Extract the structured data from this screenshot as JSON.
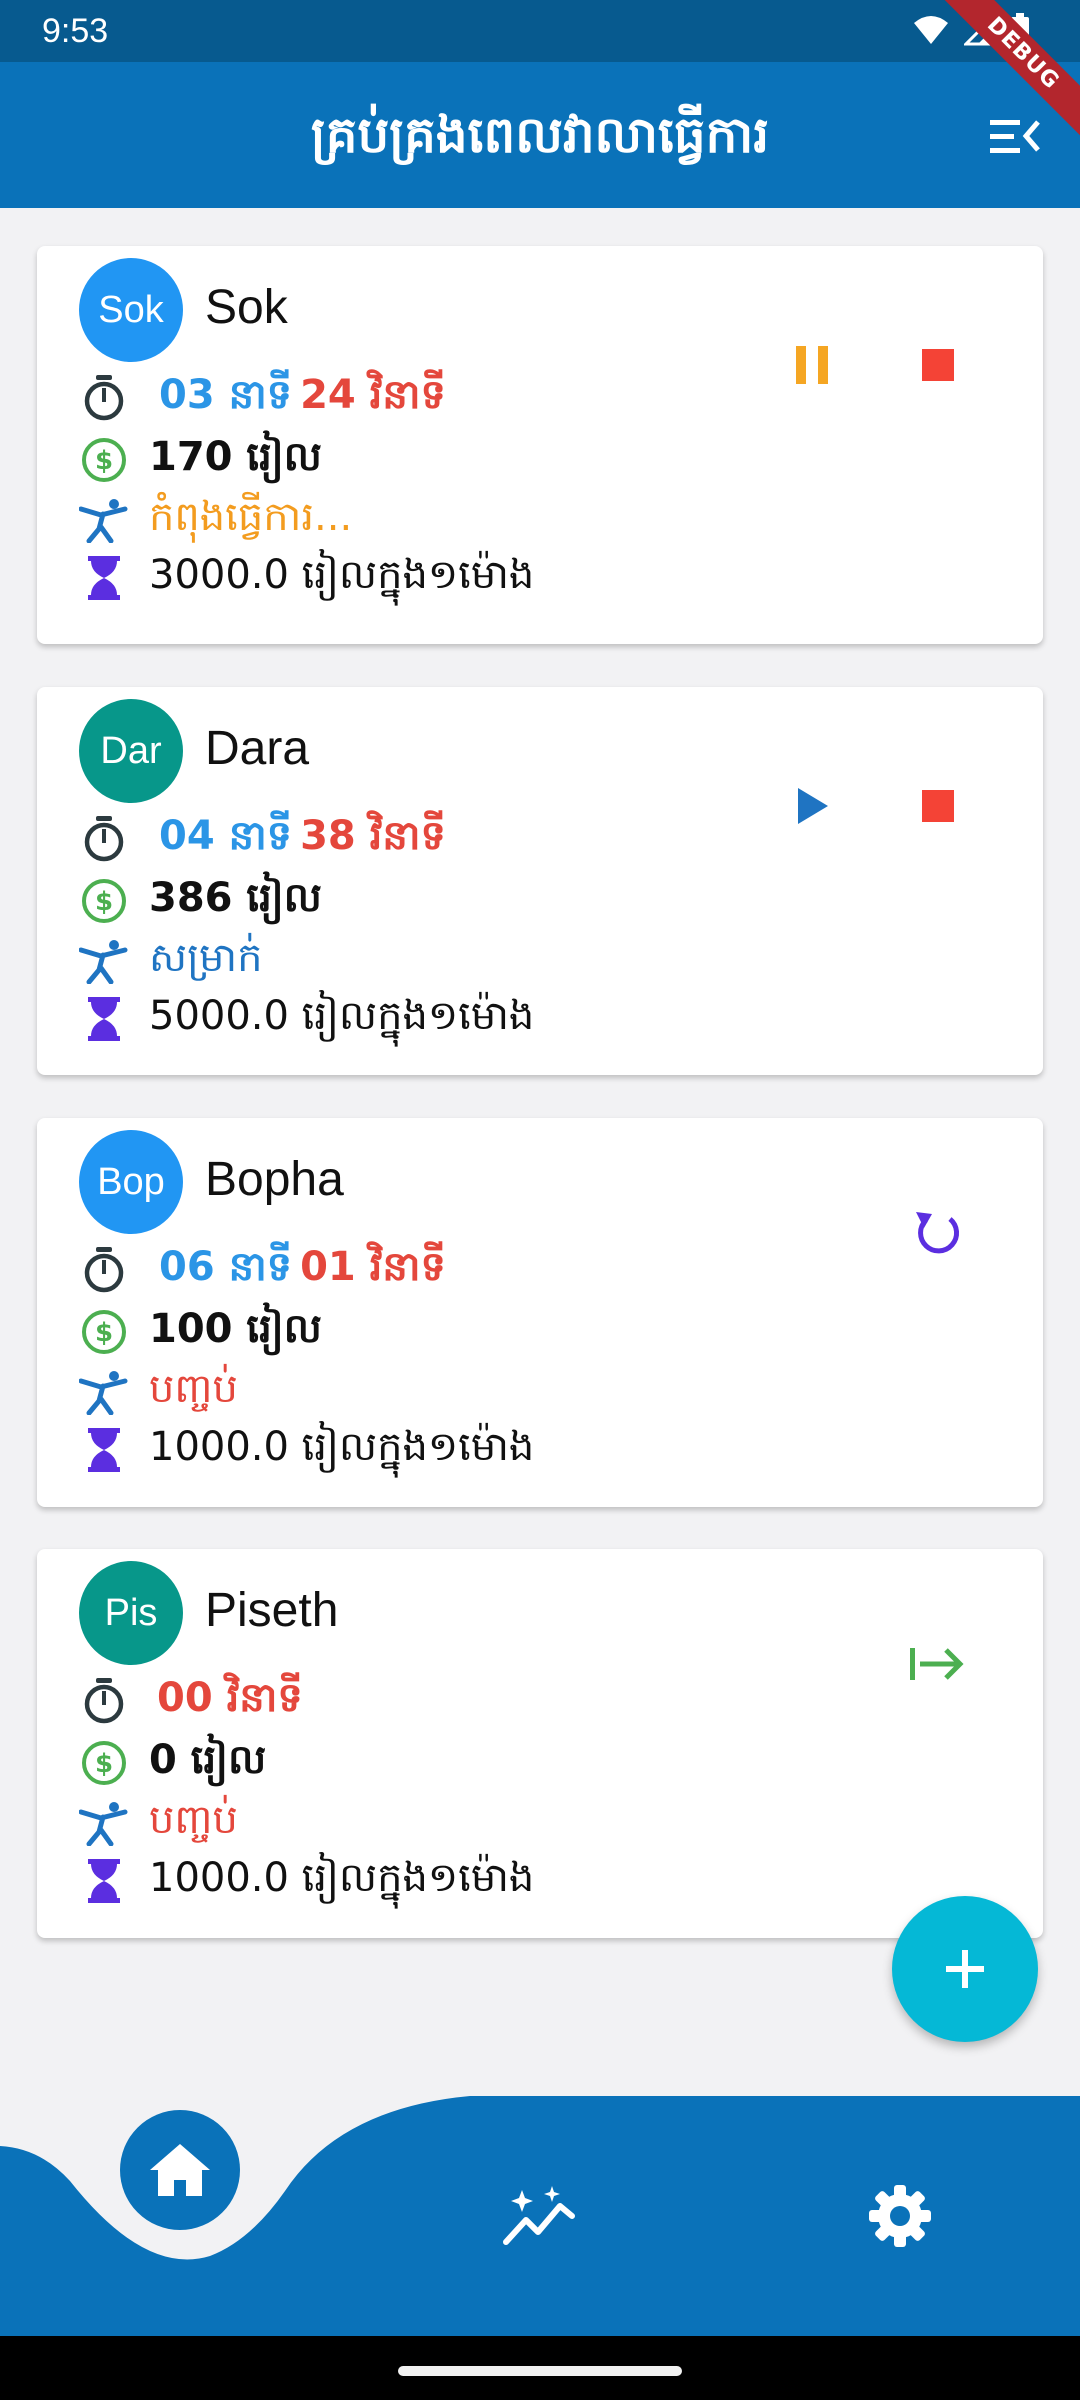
{
  "status_bar": {
    "time": "9:53"
  },
  "debug_banner": "DEBUG",
  "app_bar": {
    "title": "គ្រប់គ្រងពេលវាលាធ្វើការ"
  },
  "employees": [
    {
      "initials": "Sok",
      "name": "Sok",
      "avatar_color": "#2196f3",
      "minutes": "03 នាទី",
      "seconds": "24 វិនាទី",
      "earned": "170 រៀល",
      "status": "កំពុងធ្វើការ...",
      "status_type": "working",
      "rate": "3000.0 រៀលក្នុង១ម៉ោង",
      "actions": [
        "pause-icon",
        "stop-icon"
      ]
    },
    {
      "initials": "Dar",
      "name": "Dara",
      "avatar_color": "#07978a",
      "minutes": "04 នាទី",
      "seconds": "38 វិនាទី",
      "earned": "386 រៀល",
      "status": "សម្រាក់",
      "status_type": "pause",
      "rate": "5000.0 រៀលក្នុង១ម៉ោង",
      "actions": [
        "play-icon",
        "stop-icon"
      ]
    },
    {
      "initials": "Bop",
      "name": "Bopha",
      "avatar_color": "#2196f3",
      "minutes": "06 នាទី",
      "seconds": "01 វិនាទី",
      "earned": "100 រៀល",
      "status": "បញ្ចប់",
      "status_type": "finish",
      "rate": "1000.0 រៀលក្នុង១ម៉ោង",
      "actions": [
        "reset-icon"
      ]
    },
    {
      "initials": "Pis",
      "name": "Piseth",
      "avatar_color": "#07978a",
      "minutes": "",
      "seconds": "00 វិនាទី",
      "earned": "0 រៀល",
      "status": "បញ្ចប់",
      "status_type": "finish",
      "rate": "1000.0 រៀលក្នុង១ម៉ោង",
      "actions": [
        "start-icon"
      ]
    }
  ],
  "colors": {
    "primary": "#0a72b9",
    "minutes": "#2b95e6",
    "seconds": "#e4473c",
    "money_icon": "#4caf50",
    "rate_icon": "#5b2ee0",
    "pause": "#f5a623",
    "stop": "#f44336",
    "play": "#1f74c2",
    "reset": "#5b2ee0",
    "start": "#4caf50",
    "fab": "#05b8d6"
  },
  "nav": {
    "items": [
      "home-icon",
      "insights-icon",
      "settings-icon"
    ],
    "active": "home-icon"
  }
}
